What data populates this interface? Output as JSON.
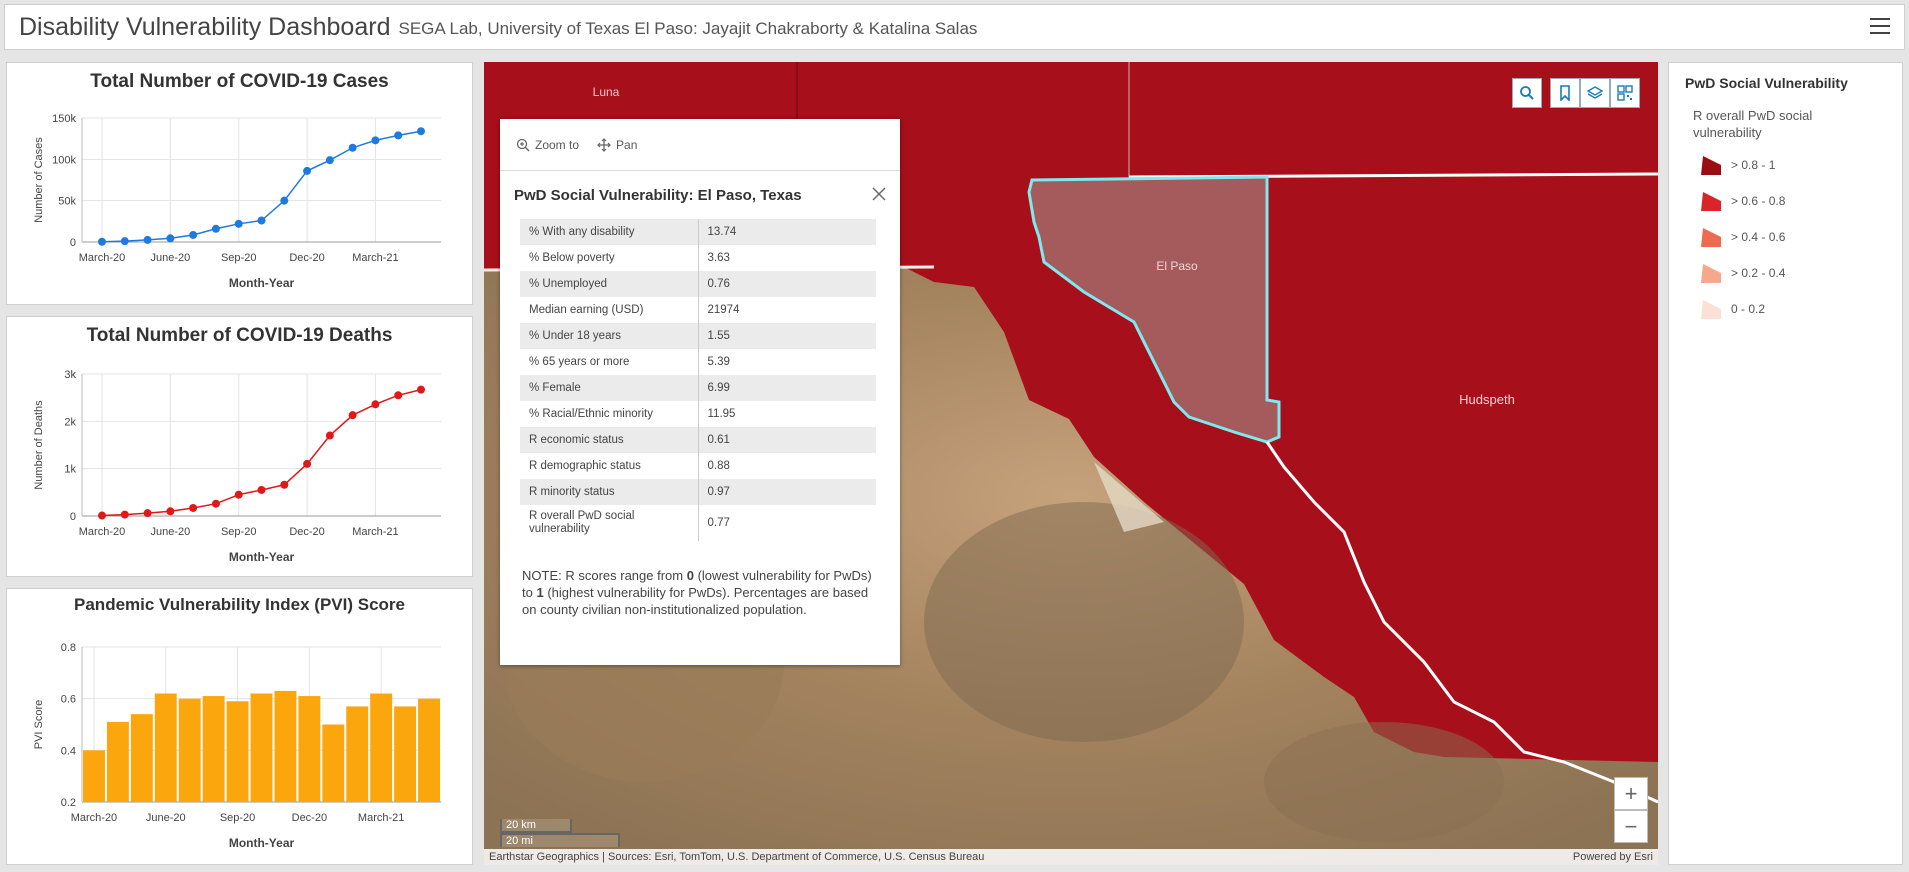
{
  "header": {
    "title": "Disability Vulnerability Dashboard",
    "subtitle": "SEGA Lab, University of Texas El Paso: Jayajit Chakraborty & Katalina Salas",
    "menu_icon": "hamburger-menu-icon"
  },
  "colors": {
    "cases_line": "#1f7ae0",
    "deaths_line": "#e01818",
    "pvi_bars": "#fba60c",
    "county_fill": "#a70f1a",
    "selected_outline": "#7fe9f0"
  },
  "chart_data": [
    {
      "id": "cases",
      "type": "line",
      "title": "Total Number of COVID-19 Cases",
      "xlabel": "Month-Year",
      "ylabel": "Number of Cases",
      "x_ticks": [
        "March-20",
        "June-20",
        "Sep-20",
        "Dec-20",
        "March-21"
      ],
      "y_ticks": [
        "0",
        "50k",
        "100k",
        "150k"
      ],
      "ylim": [
        0,
        150000
      ],
      "grid": true,
      "values": [
        300,
        1000,
        2500,
        4500,
        8500,
        16000,
        22000,
        26000,
        50000,
        86000,
        99000,
        114000,
        123000,
        129000,
        134000
      ]
    },
    {
      "id": "deaths",
      "type": "line",
      "title": "Total Number of COVID-19 Deaths",
      "xlabel": "Month-Year",
      "ylabel": "Number of Deaths",
      "x_ticks": [
        "March-20",
        "June-20",
        "Sep-20",
        "Dec-20",
        "March-21"
      ],
      "y_ticks": [
        "0",
        "1k",
        "2k",
        "3k"
      ],
      "ylim": [
        0,
        3000
      ],
      "grid": true,
      "values": [
        10,
        30,
        60,
        100,
        170,
        260,
        450,
        550,
        660,
        1100,
        1700,
        2130,
        2360,
        2550,
        2670
      ]
    },
    {
      "id": "pvi",
      "type": "bar",
      "title": "Pandemic Vulnerability Index (PVI) Score",
      "xlabel": "Month-Year",
      "ylabel": "PVI Score",
      "x_ticks": [
        "March-20",
        "June-20",
        "Sep-20",
        "Dec-20",
        "March-21"
      ],
      "y_ticks": [
        "0.2",
        "0.4",
        "0.6",
        "0.8"
      ],
      "ylim": [
        0.2,
        0.8
      ],
      "grid": true,
      "values": [
        0.4,
        0.51,
        0.54,
        0.62,
        0.6,
        0.61,
        0.59,
        0.62,
        0.63,
        0.61,
        0.5,
        0.57,
        0.62,
        0.57,
        0.6
      ]
    }
  ],
  "map": {
    "labels": {
      "luna": "Luna",
      "el_paso": "El Paso",
      "hudspeth": "Hudspeth"
    },
    "tools": [
      "search-icon",
      "bookmark-icon",
      "layers-icon",
      "qr-code-icon"
    ],
    "popup": {
      "actions": {
        "zoom_to": "Zoom to",
        "pan": "Pan"
      },
      "title": "PwD Social Vulnerability: El Paso, Texas",
      "rows": [
        {
          "k": "% With any disability",
          "v": "13.74"
        },
        {
          "k": "% Below poverty",
          "v": "3.63"
        },
        {
          "k": "% Unemployed",
          "v": "0.76"
        },
        {
          "k": "Median earning (USD)",
          "v": "21974"
        },
        {
          "k": "% Under 18 years",
          "v": "1.55"
        },
        {
          "k": "% 65 years or more",
          "v": "5.39"
        },
        {
          "k": "% Female",
          "v": "6.99"
        },
        {
          "k": "% Racial/Ethnic minority",
          "v": "11.95"
        },
        {
          "k": "R economic status",
          "v": "0.61"
        },
        {
          "k": "R demographic status",
          "v": "0.88"
        },
        {
          "k": "R minority status",
          "v": "0.97"
        },
        {
          "k": "R overall PwD social vulnerability",
          "v": "0.77"
        }
      ],
      "note_prefix": "NOTE: R scores range from ",
      "note_zero": "0",
      "note_mid": " (lowest vulnerability for PwDs) to ",
      "note_one": "1",
      "note_suffix": " (highest vulnerability for PwDs). Percentages are based on county civilian non-institutionalized population."
    },
    "scale": {
      "km": "20 km",
      "mi": "20 mi"
    },
    "zoom": {
      "in": "+",
      "out": "−"
    },
    "attribution": "Earthstar Geographics | Sources: Esri, TomTom, U.S. Department of Commerce, U.S. Census Bureau",
    "powered_by": "Powered by Esri"
  },
  "legend": {
    "title": "PwD Social Vulnerability",
    "subtitle": "R overall PwD social vulnerability",
    "items": [
      {
        "label": "> 0.8 - 1",
        "color": "#9b0c14"
      },
      {
        "label": "> 0.6 - 0.8",
        "color": "#d8252a"
      },
      {
        "label": "> 0.4 - 0.6",
        "color": "#ee6a50"
      },
      {
        "label": "> 0.2 - 0.4",
        "color": "#f7a88c"
      },
      {
        "label": "0 - 0.2",
        "color": "#fbe0d6"
      }
    ]
  }
}
